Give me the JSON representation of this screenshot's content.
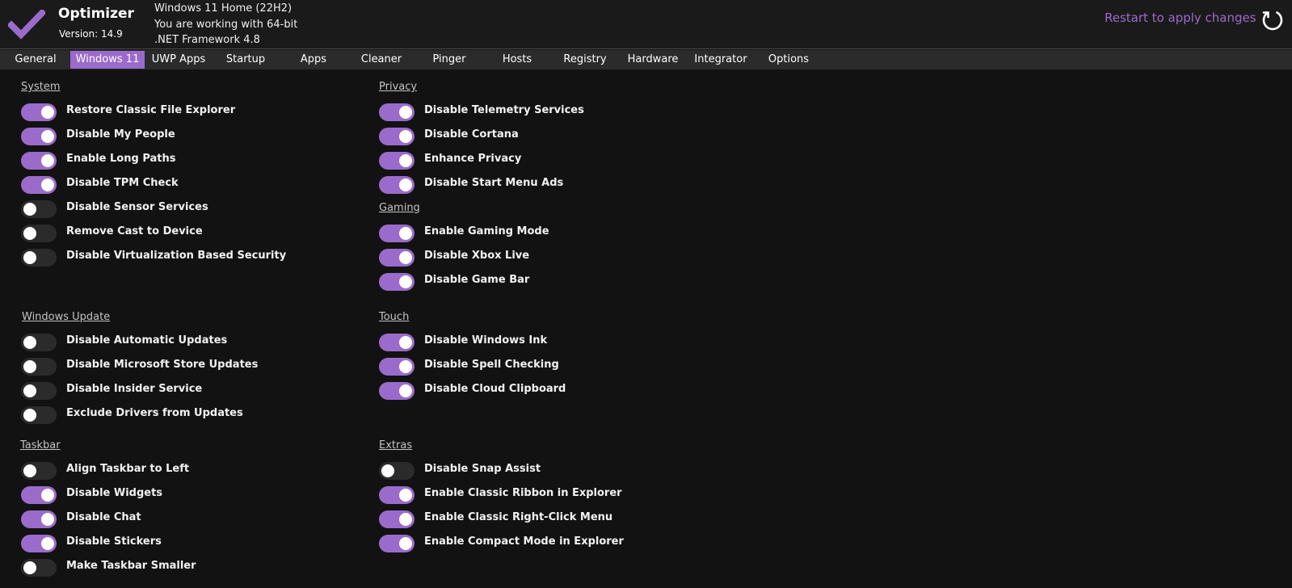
{
  "app": {
    "title": "Optimizer",
    "version": "Version: 14.9",
    "accent_color": "#9b6bcb",
    "logo_icon": "check-icon"
  },
  "system_info": {
    "os": "Windows 11 Home (22H2)",
    "arch": "You are working with 64-bit",
    "framework": ".NET Framework 4.8"
  },
  "restart": {
    "label": "Restart to apply changes",
    "icon": "restart-icon"
  },
  "tabs": [
    {
      "label": "General",
      "active": false
    },
    {
      "label": "Windows 11",
      "active": true
    },
    {
      "label": "UWP Apps",
      "active": false
    },
    {
      "label": "Startup",
      "active": false
    },
    {
      "label": "Apps",
      "active": false
    },
    {
      "label": "Cleaner",
      "active": false
    },
    {
      "label": "Pinger",
      "active": false
    },
    {
      "label": "Hosts",
      "active": false
    },
    {
      "label": "Registry",
      "active": false
    },
    {
      "label": "Hardware",
      "active": false
    },
    {
      "label": "Integrator",
      "active": false
    },
    {
      "label": "Options",
      "active": false
    }
  ],
  "sections": {
    "system": {
      "title": "System",
      "options": [
        {
          "label": "Restore Classic File Explorer",
          "on": true
        },
        {
          "label": "Disable My People",
          "on": true
        },
        {
          "label": "Enable Long Paths",
          "on": true
        },
        {
          "label": "Disable TPM Check",
          "on": true
        },
        {
          "label": "Disable Sensor Services",
          "on": false
        },
        {
          "label": "Remove Cast to Device",
          "on": false
        },
        {
          "label": "Disable Virtualization Based Security",
          "on": false
        }
      ]
    },
    "windows_update": {
      "title": "Windows Update",
      "options": [
        {
          "label": "Disable Automatic Updates",
          "on": false
        },
        {
          "label": "Disable Microsoft Store Updates",
          "on": false
        },
        {
          "label": "Disable Insider Service",
          "on": false
        },
        {
          "label": "Exclude Drivers from Updates",
          "on": false
        }
      ]
    },
    "taskbar": {
      "title": "Taskbar",
      "options": [
        {
          "label": "Align Taskbar to Left",
          "on": false
        },
        {
          "label": "Disable Widgets",
          "on": true
        },
        {
          "label": "Disable Chat",
          "on": true
        },
        {
          "label": "Disable Stickers",
          "on": true
        },
        {
          "label": "Make Taskbar Smaller",
          "on": false
        }
      ]
    },
    "privacy": {
      "title": "Privacy",
      "options": [
        {
          "label": "Disable Telemetry Services",
          "on": true
        },
        {
          "label": "Disable Cortana",
          "on": true
        },
        {
          "label": "Enhance Privacy",
          "on": true
        },
        {
          "label": "Disable Start Menu Ads",
          "on": true
        }
      ]
    },
    "gaming": {
      "title": "Gaming",
      "options": [
        {
          "label": "Enable Gaming Mode",
          "on": true
        },
        {
          "label": "Disable Xbox Live",
          "on": true
        },
        {
          "label": "Disable Game Bar",
          "on": true
        }
      ]
    },
    "touch": {
      "title": "Touch",
      "options": [
        {
          "label": "Disable Windows Ink",
          "on": true
        },
        {
          "label": "Disable Spell Checking",
          "on": true
        },
        {
          "label": "Disable Cloud Clipboard",
          "on": true
        }
      ]
    },
    "extras": {
      "title": "Extras",
      "options": [
        {
          "label": "Disable Snap Assist",
          "on": false
        },
        {
          "label": "Enable Classic Ribbon in Explorer",
          "on": true
        },
        {
          "label": "Enable Classic Right-Click Menu",
          "on": true
        },
        {
          "label": "Enable Compact Mode in Explorer",
          "on": true
        }
      ]
    }
  }
}
